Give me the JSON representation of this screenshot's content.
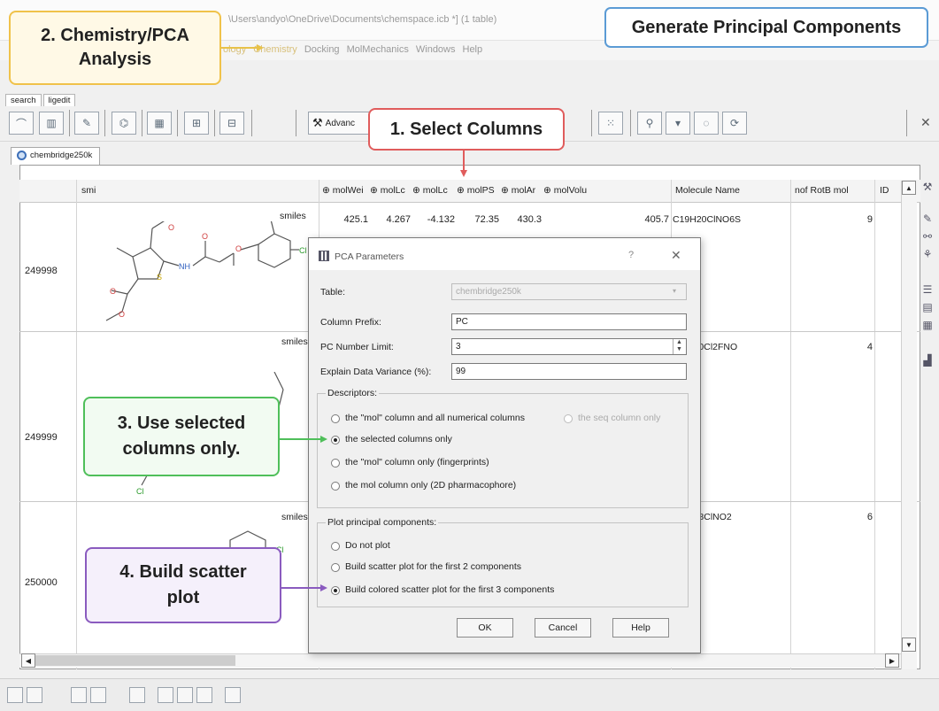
{
  "window": {
    "title": "\\Users\\andyo\\OneDrive\\Documents\\chemspace.icb *] (1 table)",
    "menu": [
      "ology",
      "Chemistry",
      "Docking",
      "MolMechanics",
      "Windows",
      "Help"
    ]
  },
  "toolbar": {
    "tabs": [
      "search",
      "ligedit"
    ],
    "advanced_label": "Advanc"
  },
  "document_tab": {
    "label": "chembridge250k"
  },
  "table": {
    "columns": [
      "smi",
      "molWei",
      "molLc",
      "molLc",
      "molPS",
      "molAr",
      "molVolu",
      "Molecule Name",
      "nof RotB mol",
      "ID"
    ],
    "rows": [
      {
        "id": "249998",
        "smiles_label": "smiles",
        "values": [
          "425.1",
          "4.267",
          "-4.132",
          "72.35",
          "430.3",
          "405.7"
        ],
        "name": "C19H20ClNO6S",
        "rotb": "9"
      },
      {
        "id": "249999",
        "smiles_label": "smiles",
        "name": "H10Cl2FNO",
        "rotb": "4"
      },
      {
        "id": "250000",
        "smiles_label": "smiles",
        "name": "H18ClNO2",
        "rotb": "6"
      }
    ]
  },
  "dialog": {
    "title": "PCA Parameters",
    "help_glyph": "?",
    "close_glyph": "✕",
    "table_label": "Table:",
    "table_value": "chembridge250k",
    "prefix_label": "Column Prefix:",
    "prefix_value": "PC",
    "limit_label": "PC Number Limit:",
    "limit_value": "3",
    "variance_label": "Explain Data Variance (%):",
    "variance_value": "99",
    "descriptors_label": "Descriptors:",
    "descriptor_options": [
      "the \"mol\" column and all numerical columns",
      "the seq column only",
      "the selected columns only",
      "the \"mol\" column only (fingerprints)",
      "the mol column only (2D pharmacophore)"
    ],
    "plot_label": "Plot principal components:",
    "plot_options": [
      "Do not plot",
      "Build scatter plot for the first 2 components",
      "Build colored scatter plot for the first 3 components"
    ],
    "ok_label": "OK",
    "cancel_label": "Cancel",
    "help_label": "Help"
  },
  "callouts": {
    "generate": "Generate Principal Components",
    "chemistry_line1": "2. Chemistry/PCA",
    "chemistry_line2": "Analysis",
    "select": "1. Select Columns",
    "use_line1": "3. Use selected",
    "use_line2": "columns only.",
    "build_line1": "4. Build scatter",
    "build_line2": "plot"
  },
  "colors": {
    "callout_blue": "#5b9bd5",
    "callout_yellow": "#f0c24a",
    "callout_red": "#e05c5c",
    "callout_green": "#4fbf5a",
    "callout_purple": "#8a5bbf"
  }
}
